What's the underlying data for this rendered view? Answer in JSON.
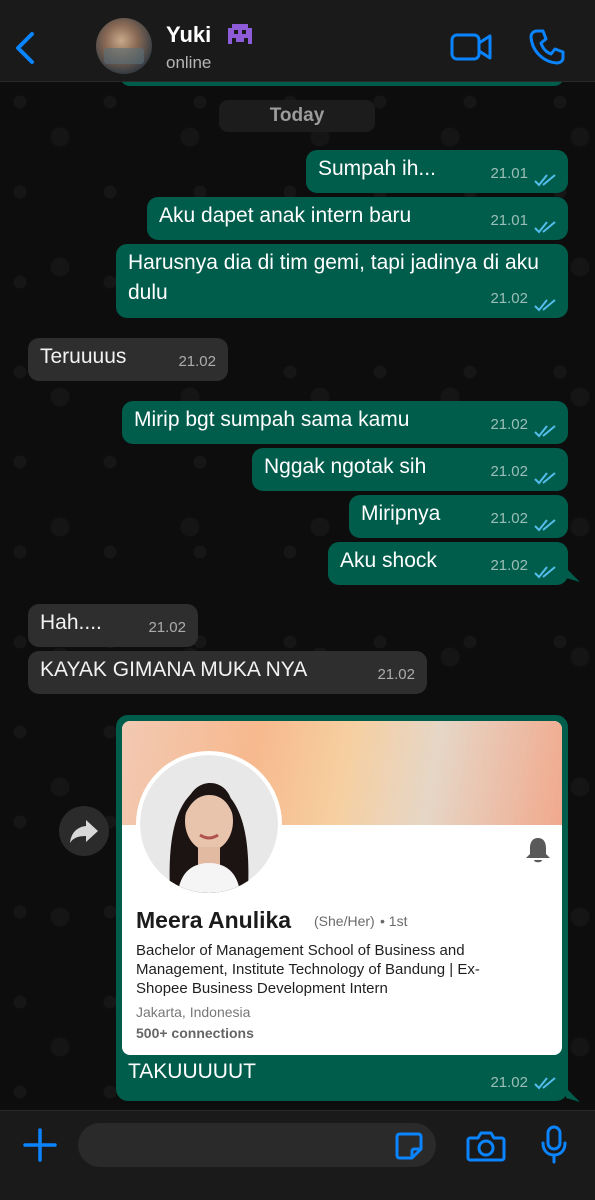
{
  "header": {
    "contact_name": "Yuki",
    "status": "online"
  },
  "chat": {
    "date_label": "Today",
    "messages": [
      {
        "dir": "out",
        "text": "Sumpah ih...",
        "time": "21.01",
        "read": true
      },
      {
        "dir": "out",
        "text": "Aku dapet anak intern baru",
        "time": "21.01",
        "read": true
      },
      {
        "dir": "out",
        "text": "Harusnya dia di tim gemi, tapi jadinya di aku dulu",
        "time": "21.02",
        "read": true
      },
      {
        "dir": "in",
        "text": "Teruuuus",
        "time": "21.02"
      },
      {
        "dir": "out",
        "text": "Mirip bgt sumpah sama kamu",
        "time": "21.02",
        "read": true
      },
      {
        "dir": "out",
        "text": "Nggak ngotak sih",
        "time": "21.02",
        "read": true
      },
      {
        "dir": "out",
        "text": "Miripnya",
        "time": "21.02",
        "read": true
      },
      {
        "dir": "out",
        "text": "Aku shock",
        "time": "21.02",
        "read": true
      },
      {
        "dir": "in",
        "text": "Hah....",
        "time": "21.02"
      },
      {
        "dir": "in",
        "text": "KAYAK GIMANA MUKA NYA",
        "time": "21.02"
      }
    ],
    "shared_profile": {
      "name": "Meera Anulika",
      "pronouns": "(She/Her)",
      "degree": "• 1st",
      "headline": "Bachelor of Management School of Business and Management, Institute Technology of Bandung | Ex-Shopee Business Development Intern",
      "location": "Jakarta, Indonesia",
      "connections": "500+ connections",
      "caption": "TAKUUUUUT",
      "time": "21.02"
    }
  },
  "composer": {
    "input_value": "",
    "input_placeholder": ""
  },
  "colors": {
    "accent": "#0a84ff",
    "outgoing_bubble": "#005c4b",
    "incoming_bubble": "#2e2e2e",
    "read_ticks": "#53bdeb"
  },
  "icons": [
    "back-chevron-icon",
    "alien-monster-emoji-icon",
    "video-camera-icon",
    "phone-icon",
    "forward-icon",
    "bell-icon",
    "plus-icon",
    "sticker-icon",
    "camera-icon",
    "microphone-icon"
  ]
}
